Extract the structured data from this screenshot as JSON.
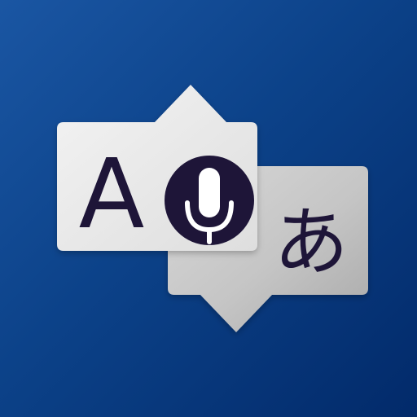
{
  "app": {
    "name_visible": false
  },
  "icon": {
    "semantic": "translator-voice-app-icon",
    "source_letter": "A",
    "target_letter": "あ",
    "glyph_color": "#1e1538",
    "microphone_disc_color": "#1e1538",
    "microphone_symbol_color": "#ffffff",
    "left_bubble_color": "#ececec",
    "right_bubble_color": "#c9c9c9",
    "background_gradient_start": "#1a56a3",
    "background_gradient_end": "#022a6a"
  }
}
